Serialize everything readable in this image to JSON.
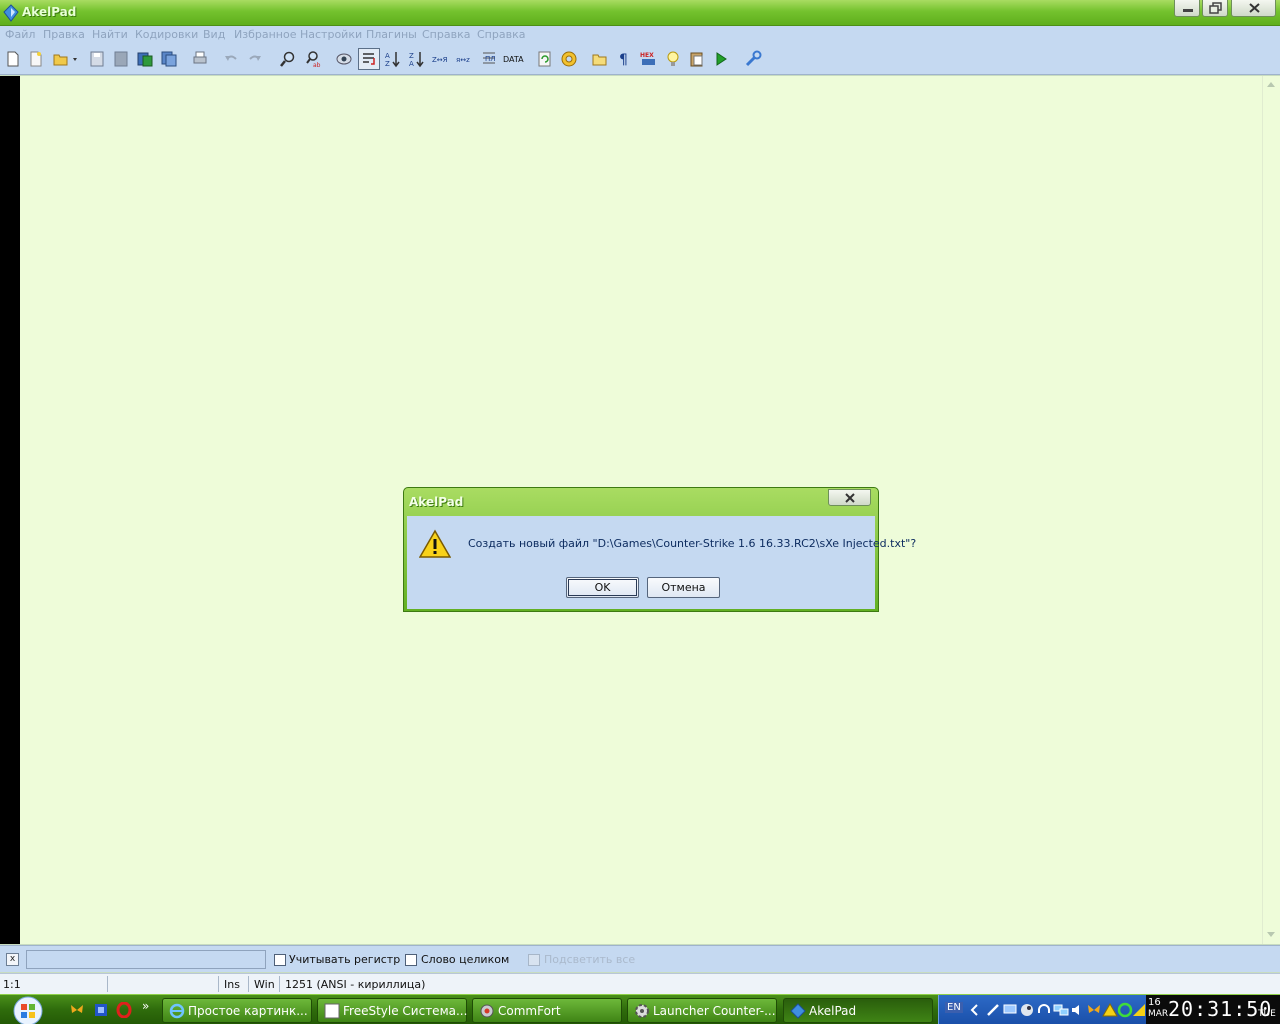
{
  "window": {
    "title": "AkelPad"
  },
  "menu": {
    "items": [
      "Файл",
      "Правка",
      "Найти",
      "Кодировки",
      "Вид",
      "Избранное",
      "Настройки",
      "Плагины",
      "Справка",
      "Справка"
    ]
  },
  "toolbar": {
    "icons": [
      "new-file-icon",
      "new-window-icon",
      "open-folder-icon",
      "save-icon",
      "save-disabled-icon",
      "save-all-icon",
      "copy-files-icon",
      "print-icon",
      "undo-icon",
      "redo-icon",
      "find-icon",
      "replace-icon",
      "goto-icon",
      "word-wrap-icon",
      "sort-asc-icon",
      "sort-desc-icon",
      "case-icon",
      "case-upper-icon",
      "spaces-icon",
      "data-icon",
      "refresh-icon",
      "settings-gear-icon",
      "open-favorite-icon",
      "pilcrow-icon",
      "hex-icon",
      "lightbulb-icon",
      "clipboard-icon",
      "play-icon",
      "tools-icon"
    ],
    "case_label": "Z↔Я",
    "case_upper_label": "я↔z",
    "data_label": "DATA",
    "hex_label": "HEX"
  },
  "findbar": {
    "close_label": "x",
    "input_value": "",
    "match_case_label": "Учитывать регистр",
    "whole_word_label": "Слово целиком",
    "highlight_all_label": "Подсветить все"
  },
  "statusbar": {
    "position": "1:1",
    "insert_mode": "Ins",
    "newline": "Win",
    "codepage": "1251  (ANSI - кириллица)"
  },
  "dialog": {
    "title": "AkelPad",
    "message": "Создать новый файл \"D:\\Games\\Counter-Strike 1.6 16.33.RC2\\sXe Injected.txt\"?",
    "ok_label": "OK",
    "cancel_label": "Отмена"
  },
  "taskbar": {
    "tasks": [
      {
        "label": "Простое картинк...",
        "icon": "ie-icon"
      },
      {
        "label": "FreeStyle Система...",
        "icon": "window-icon"
      },
      {
        "label": "CommFort",
        "icon": "commfort-icon"
      },
      {
        "label": "Launcher Counter-...",
        "icon": "gear-icon"
      },
      {
        "label": "AkelPad",
        "icon": "akelpad-icon"
      }
    ],
    "quicklaunch_more": "»",
    "language": "EN",
    "clock": {
      "day": "16",
      "month": "MAR",
      "time": "20:31:50",
      "weekday": "TUE"
    }
  },
  "colors": {
    "titlebar_green": "#74c22e",
    "editor_bg": "#eefcd9",
    "panel_blue": "#c5d9f1",
    "dialog_text": "#0b2a5e"
  }
}
